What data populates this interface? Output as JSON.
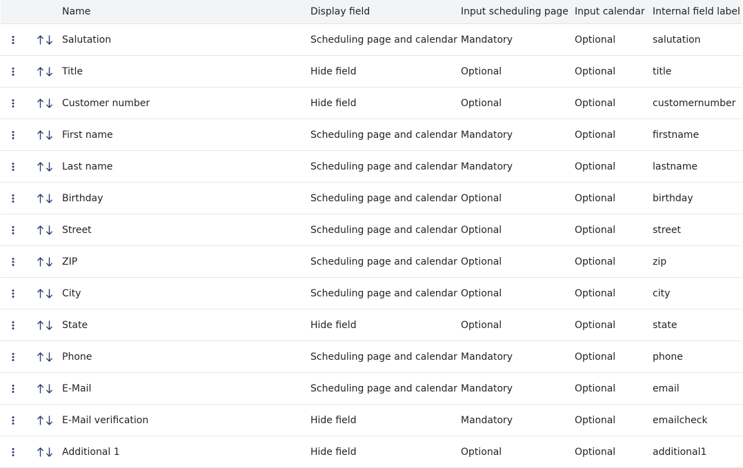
{
  "colors": {
    "header_bg": "#f3f4f6",
    "row_border": "#e3e5e8",
    "icon": "#2a3e6b",
    "text": "#222222"
  },
  "columns": {
    "name": "Name",
    "display": "Display field",
    "input_sched": "Input scheduling page",
    "input_cal": "Input calendar",
    "internal": "Internal field label"
  },
  "rows": [
    {
      "name": "Salutation",
      "display": "Scheduling page and calendar",
      "input_sched": "Mandatory",
      "input_cal": "Optional",
      "internal": "salutation"
    },
    {
      "name": "Title",
      "display": "Hide field",
      "input_sched": "Optional",
      "input_cal": "Optional",
      "internal": "title"
    },
    {
      "name": "Customer number",
      "display": "Hide field",
      "input_sched": "Optional",
      "input_cal": "Optional",
      "internal": "customernumber"
    },
    {
      "name": "First name",
      "display": "Scheduling page and calendar",
      "input_sched": "Mandatory",
      "input_cal": "Optional",
      "internal": "firstname"
    },
    {
      "name": "Last name",
      "display": "Scheduling page and calendar",
      "input_sched": "Mandatory",
      "input_cal": "Optional",
      "internal": "lastname"
    },
    {
      "name": "Birthday",
      "display": "Scheduling page and calendar",
      "input_sched": "Optional",
      "input_cal": "Optional",
      "internal": "birthday"
    },
    {
      "name": "Street",
      "display": "Scheduling page and calendar",
      "input_sched": "Optional",
      "input_cal": "Optional",
      "internal": "street"
    },
    {
      "name": "ZIP",
      "display": "Scheduling page and calendar",
      "input_sched": "Optional",
      "input_cal": "Optional",
      "internal": "zip"
    },
    {
      "name": "City",
      "display": "Scheduling page and calendar",
      "input_sched": "Optional",
      "input_cal": "Optional",
      "internal": "city"
    },
    {
      "name": "State",
      "display": "Hide field",
      "input_sched": "Optional",
      "input_cal": "Optional",
      "internal": "state"
    },
    {
      "name": "Phone",
      "display": "Scheduling page and calendar",
      "input_sched": "Mandatory",
      "input_cal": "Optional",
      "internal": "phone"
    },
    {
      "name": "E-Mail",
      "display": "Scheduling page and calendar",
      "input_sched": "Mandatory",
      "input_cal": "Optional",
      "internal": "email"
    },
    {
      "name": "E-Mail verification",
      "display": "Hide field",
      "input_sched": "Mandatory",
      "input_cal": "Optional",
      "internal": "emailcheck"
    },
    {
      "name": "Additional 1",
      "display": "Hide field",
      "input_sched": "Optional",
      "input_cal": "Optional",
      "internal": "additional1"
    }
  ]
}
